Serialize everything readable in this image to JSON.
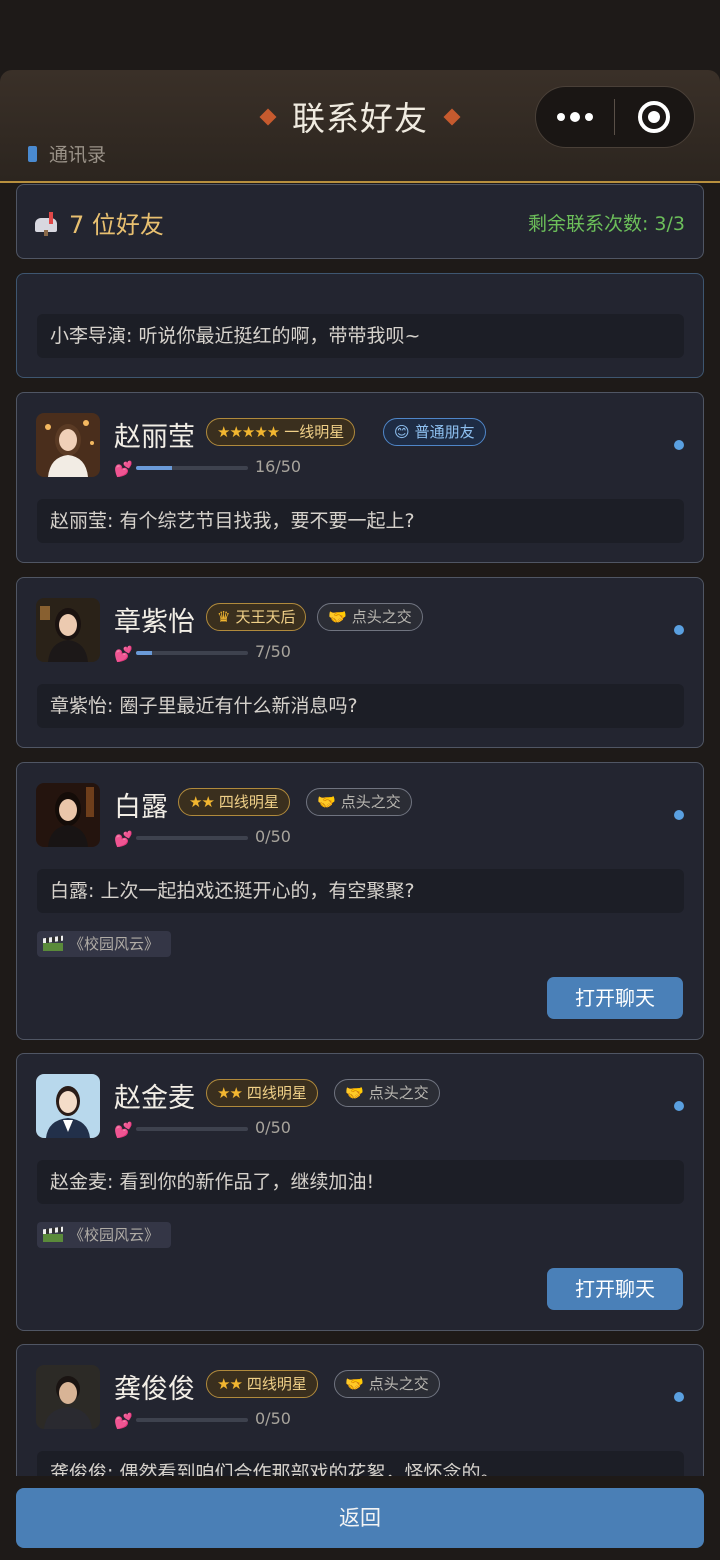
{
  "header": {
    "title": "联系好友",
    "subtitle": "通讯录"
  },
  "summary": {
    "count_label": "7 位好友",
    "remaining": "剩余联系次数: 3/3"
  },
  "notice": {
    "message": "小李导演: 听说你最近挺红的啊，带带我呗~"
  },
  "friends": [
    {
      "name": "赵丽莹",
      "rank_stars": "★★★★★",
      "rank_label": "一线明星",
      "relation_icon": "smile-icon",
      "relation": "普通朋友",
      "favor": "16/50",
      "favor_ratio": 0.32,
      "message": "赵丽莹: 有个综艺节目找我，要不要一起上?"
    },
    {
      "name": "章紫怡",
      "rank_icon": "crown-icon",
      "rank_label": "天王天后",
      "relation_icon": "handshake-icon",
      "relation": "点头之交",
      "favor": "7/50",
      "favor_ratio": 0.14,
      "message": "章紫怡: 圈子里最近有什么新消息吗?"
    },
    {
      "name": "白露",
      "rank_stars": "★★",
      "rank_label": "四线明星",
      "relation_icon": "handshake-icon",
      "relation": "点头之交",
      "favor": "0/50",
      "favor_ratio": 0,
      "message": "白露: 上次一起拍戏还挺开心的，有空聚聚?",
      "tag": "《校园风云》",
      "action": "打开聊天"
    },
    {
      "name": "赵金麦",
      "rank_stars": "★★",
      "rank_label": "四线明星",
      "relation_icon": "handshake-icon",
      "relation": "点头之交",
      "favor": "0/50",
      "favor_ratio": 0,
      "message": "赵金麦: 看到你的新作品了，继续加油!",
      "tag": "《校园风云》",
      "action": "打开聊天"
    },
    {
      "name": "龚俊俊",
      "rank_stars": "★★",
      "rank_label": "四线明星",
      "relation_icon": "handshake-icon",
      "relation": "点头之交",
      "favor": "0/50",
      "favor_ratio": 0,
      "message": "龚俊俊: 偶然看到咱们合作那部戏的花絮，怪怀念的。"
    }
  ],
  "footer": {
    "back_label": "返回"
  },
  "colors": {
    "accent_gold": "#e8c070",
    "remaining_green": "#6cbf5a",
    "button_blue": "#4a80b8",
    "unread_dot": "#5aa0e0"
  }
}
